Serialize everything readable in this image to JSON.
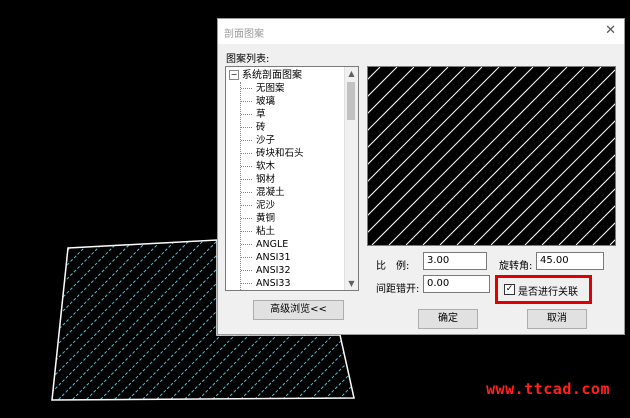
{
  "dialog": {
    "title": "剖面图案",
    "close_glyph": "✕",
    "list_label": "图案列表:",
    "tree": {
      "expander": "−",
      "root": "系统剖面图案",
      "items": [
        "无图案",
        "玻璃",
        "草",
        "砖",
        "沙子",
        "砖块和石头",
        "软木",
        "钢材",
        "混凝土",
        "泥沙",
        "黄铜",
        "粘土",
        "ANGLE",
        "ANSI31",
        "ANSI32",
        "ANSI33"
      ]
    },
    "scale": {
      "label": "比　例:",
      "value": "3.00"
    },
    "rotation": {
      "label": "旋转角:",
      "value": "45.00"
    },
    "spacing": {
      "label": "间距错开:",
      "value": "0.00"
    },
    "associate": {
      "label": "是否进行关联",
      "checked": true,
      "check_glyph": "✓"
    },
    "buttons": {
      "advanced": "高级浏览<<",
      "ok": "确定",
      "cancel": "取消"
    },
    "scroll_up_glyph": "▲",
    "scroll_down_glyph": "▼",
    "preview_hatch_color": "#ffffff",
    "highlight_color": "#e00000"
  },
  "watermark": "www.ttcad.com",
  "colors": {
    "background": "#000000",
    "cad_hatch": "#35c8e8",
    "cad_outline": "#ffffff"
  }
}
